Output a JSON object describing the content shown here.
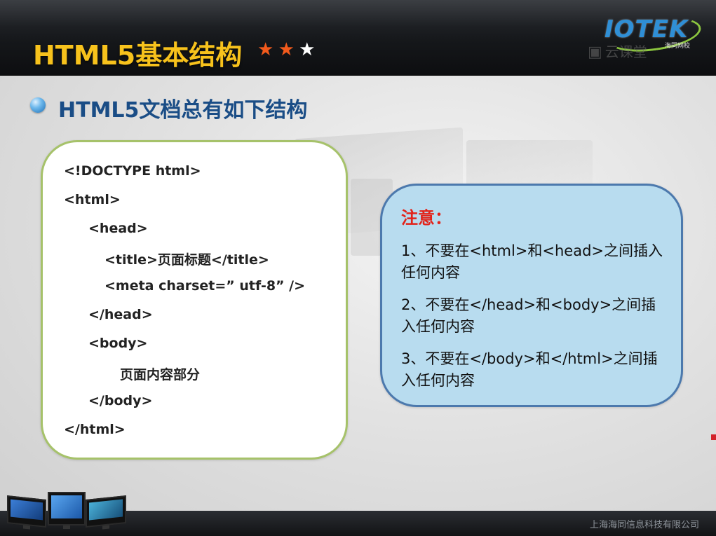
{
  "header": {
    "title": "HTML5基本结构",
    "stars": [
      {
        "glyph": "★",
        "color": "#f25a1c"
      },
      {
        "glyph": "★",
        "color": "#f25a1c"
      },
      {
        "glyph": "★",
        "color": "#ffffff"
      }
    ],
    "logo_text": "IOTEK",
    "logo_sub": "海同网校",
    "cloud_text": "云课堂",
    "cloud_icon": "cloud-classroom-icon"
  },
  "subtitle": "HTML5文档总有如下结构",
  "code_lines": [
    "<!DOCTYPE html>",
    "<html>",
    "<head>",
    "<title>页面标题</title>",
    "<meta charset=” utf-8” />",
    "</head>",
    "<body>",
    "页面内容部分",
    "</body>",
    "</html>"
  ],
  "note": {
    "title": "注意：",
    "items": [
      "1、不要在<html>和<head>之间插入任何内容",
      "2、不要在</head>和<body>之间插入任何内容",
      "3、不要在</body>和</html>之间插入任何内容"
    ]
  },
  "footer": {
    "company": "上海海同信息科技有限公司"
  },
  "colors": {
    "title_gold": "#f7c21c",
    "subtitle_blue": "#1a4d86",
    "note_red": "#e2231a",
    "code_border": "#a6c26a",
    "note_border": "#4c79ad",
    "note_bg": "#b8dcef"
  }
}
